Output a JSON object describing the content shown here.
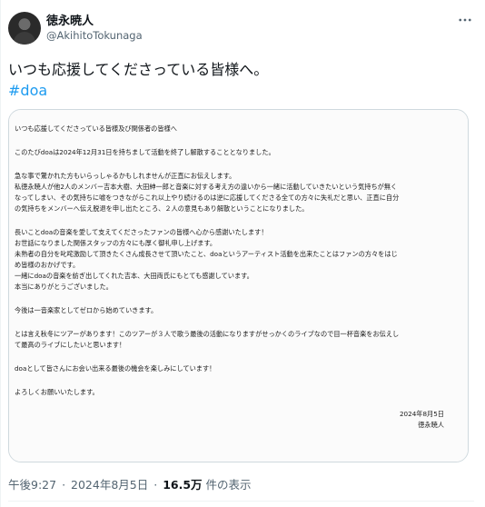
{
  "author": {
    "name": "徳永暁人",
    "handle": "@AkihitoTokunaga"
  },
  "tweet": {
    "text": "いつも応援してくださっている皆様へ。",
    "hashtag": "#doa"
  },
  "document": {
    "lines": [
      "いつも応援してくださっている皆様及び関係者の皆様へ",
      "",
      "このたびdoaは2024年12月31日を持ちまして活動を終了し解散することとなりました。",
      "",
      "急な事で驚かれた方もいらっしゃるかもしれませんが正直にお伝えします。",
      "私徳永暁人が他2人のメンバー吉本大樹、大田紳一郎と音楽に対する考え方の違いから一緒に活動していきたいという気持ちが無く",
      "なってしまい、その気持ちに嘘をつきながらこれ以上やり続けるのは逆に応援してくださる全ての方々に失礼だと思い、正直に自分",
      "の気持ちをメンバーへ伝え脱退を申し出たところ、２人の意見もあり解散ということになりました。",
      "",
      "長いことdoaの音楽を愛して支えてくださったファンの皆様へ心から感謝いたします！",
      "お世話になりました関係スタッフの方々にも厚く御礼申し上げます。",
      "未熟者の自分を叱咤激励して頂きたくさん成長させて頂いたこと、doaというアーティスト活動を出来たことはファンの方々をはじ",
      "め皆様のおかげです。",
      "一緒にdoaの音楽を紡ぎ出してくれた吉本、大田両氏にもとても感謝しています。",
      "本当にありがとうございました。",
      "",
      "今後は一音楽家としてゼロから始めていきます。",
      "",
      "とは言え秋冬にツアーがあります！このツアーが３人で歌う最後の活動になりますがせっかくのライブなので目一杯音楽をお伝えし",
      "て最高のライブにしたいと思います！",
      "",
      "doaとして皆さんにお会い出来る最後の機会を楽しみにしています！",
      "",
      "よろしくお願いいたします。"
    ],
    "date": "2024年8月5日",
    "signature": "徳永暁人"
  },
  "meta": {
    "time": "午後9:27",
    "date": "2024年8月5日",
    "separator": "·",
    "views_count": "16.5万",
    "views_label": "件の表示"
  },
  "icons": {
    "more": "more-dots-icon"
  },
  "colors": {
    "link": "#1d9bf0",
    "secondary_text": "#536471",
    "border": "#cfd9de"
  }
}
